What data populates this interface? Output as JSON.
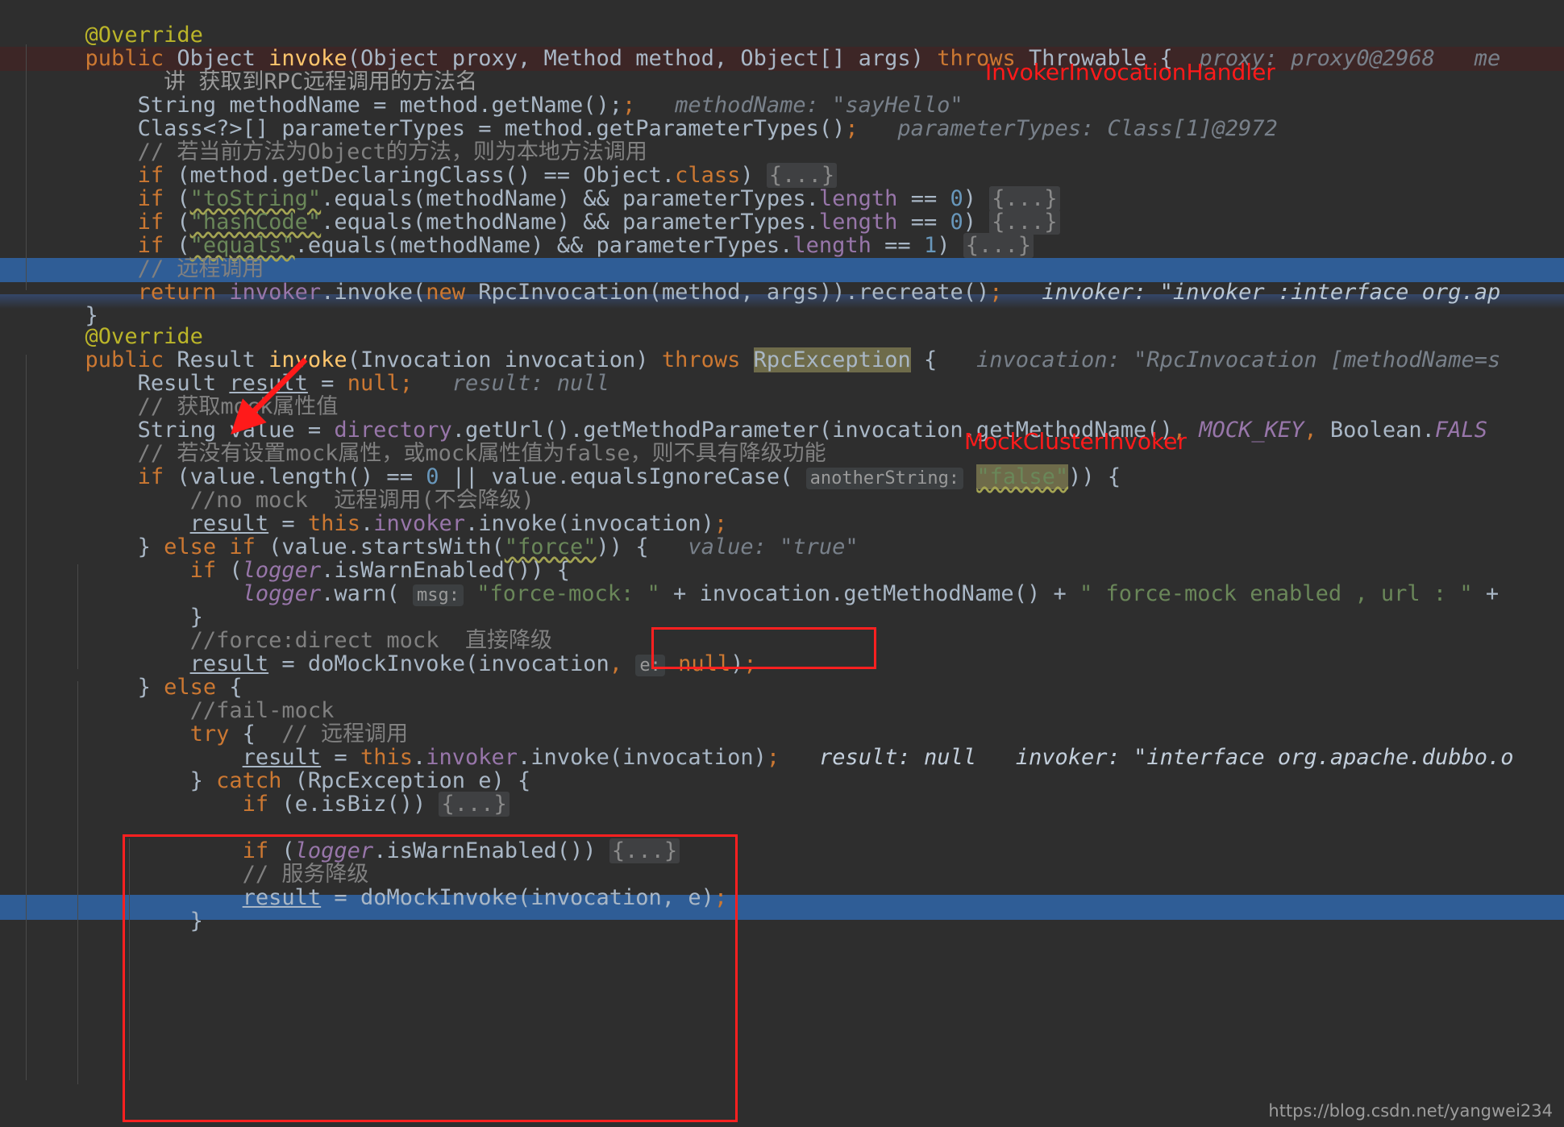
{
  "editor": {
    "theme": "darcula",
    "background": "#2e2e2e",
    "selection_color": "#2f5d96",
    "todo_color": "#3d2626",
    "accent_red": "#ff1a1a"
  },
  "annotations": {
    "class_label_top": "InvokerInvocationHandler",
    "class_label_bottom": "MockClusterInvoker"
  },
  "watermark": "https://blog.csdn.net/yangwei234",
  "lines": [
    {
      "id": "l01",
      "indent": 0,
      "text": "@Override"
    },
    {
      "id": "l02",
      "indent": 0,
      "text": "public Object invoke(Object proxy, Method method, Object[] args) throws Throwable {   proxy: proxy0@2968   me"
    },
    {
      "id": "l03",
      "indent": 1,
      "text": "讲 获取到RPC远程调用的方法名"
    },
    {
      "id": "l04",
      "indent": 1,
      "text": "String methodName = method.getName();   methodName: \"sayHello\""
    },
    {
      "id": "l05",
      "indent": 1,
      "text": "Class<?>[] parameterTypes = method.getParameterTypes();   parameterTypes: Class[1]@2972"
    },
    {
      "id": "l06",
      "indent": 1,
      "text": "// 若当前方法为Object的方法，则为本地方法调用"
    },
    {
      "id": "l07",
      "indent": 1,
      "text": "if (method.getDeclaringClass() == Object.class) {...}"
    },
    {
      "id": "l08",
      "indent": 1,
      "text": "if (\"toString\".equals(methodName) && parameterTypes.length == 0) {...}"
    },
    {
      "id": "l09",
      "indent": 1,
      "text": "if (\"hashCode\".equals(methodName) && parameterTypes.length == 0) {...}"
    },
    {
      "id": "l10",
      "indent": 1,
      "text": "if (\"equals\".equals(methodName) && parameterTypes.length == 1) {...}"
    },
    {
      "id": "l11",
      "indent": 1,
      "text": "// 远程调用"
    },
    {
      "id": "l12",
      "indent": 1,
      "text": "return invoker.invoke(new RpcInvocation(method, args)).recreate();   invoker: \"invoker :interface org.ap"
    },
    {
      "id": "l13",
      "indent": 0,
      "text": "}"
    },
    {
      "id": "l14",
      "indent": 0,
      "text": "@Override"
    },
    {
      "id": "l15",
      "indent": 0,
      "text": "public Result invoke(Invocation invocation) throws RpcException {   invocation: \"RpcInvocation [methodName=s"
    },
    {
      "id": "l16",
      "indent": 1,
      "text": "Result result = null;   result: null"
    },
    {
      "id": "l17",
      "indent": 1,
      "text": "// 获取mock属性值"
    },
    {
      "id": "l18",
      "indent": 1,
      "text": "String value = directory.getUrl().getMethodParameter(invocation.getMethodName(), MOCK_KEY, Boolean.FALS"
    },
    {
      "id": "l19",
      "indent": 1,
      "text": "// 若没有设置mock属性，或mock属性值为false，则不具有降级功能"
    },
    {
      "id": "l20",
      "indent": 1,
      "text": "if (value.length() == 0 || value.equalsIgnoreCase( anotherString: \"false\")) {"
    },
    {
      "id": "l21",
      "indent": 2,
      "text": "//no mock  远程调用(不会降级)"
    },
    {
      "id": "l22",
      "indent": 2,
      "text": "result = this.invoker.invoke(invocation);"
    },
    {
      "id": "l23",
      "indent": 1,
      "text": "} else if (value.startsWith(\"force\")) {   value: \"true\""
    },
    {
      "id": "l24",
      "indent": 2,
      "text": "if (logger.isWarnEnabled()) {"
    },
    {
      "id": "l25",
      "indent": 3,
      "text": "logger.warn( msg: \"force-mock: \" + invocation.getMethodName() + \" force-mock enabled , url : \" +"
    },
    {
      "id": "l26",
      "indent": 2,
      "text": "}"
    },
    {
      "id": "l27",
      "indent": 2,
      "text": "//force:direct mock  直接降级"
    },
    {
      "id": "l28",
      "indent": 2,
      "text": "result = doMockInvoke(invocation,  e: null);"
    },
    {
      "id": "l29",
      "indent": 1,
      "text": "} else {"
    },
    {
      "id": "l30",
      "indent": 2,
      "text": "//fail-mock"
    },
    {
      "id": "l31",
      "indent": 2,
      "text": "try {  // 远程调用"
    },
    {
      "id": "l32",
      "indent": 3,
      "text": "result = this.invoker.invoke(invocation);   result: null   invoker: \"interface org.apache.dubbo.o"
    },
    {
      "id": "l33",
      "indent": 2,
      "text": "} catch (RpcException e) {"
    },
    {
      "id": "l34",
      "indent": 3,
      "text": "if (e.isBiz()) {...}"
    },
    {
      "id": "l35",
      "indent": 3,
      "text": ""
    },
    {
      "id": "l36",
      "indent": 3,
      "text": "if (logger.isWarnEnabled()) {...}"
    },
    {
      "id": "l37",
      "indent": 3,
      "text": "// 服务降级"
    },
    {
      "id": "l38",
      "indent": 3,
      "text": "result = doMockInvoke(invocation, e);"
    },
    {
      "id": "l39",
      "indent": 2,
      "text": "}"
    }
  ],
  "inline_hints": [
    {
      "name": "proxy",
      "value": "proxy0@2968"
    },
    {
      "name": "methodName",
      "value": "\"sayHello\""
    },
    {
      "name": "parameterTypes",
      "value": "Class[1]@2972"
    },
    {
      "name": "invoker",
      "value": "\"invoker :interface org.ap"
    },
    {
      "name": "invocation",
      "value": "\"RpcInvocation [methodName=s"
    },
    {
      "name": "result",
      "value": "null"
    },
    {
      "name": "value",
      "value": "\"true\""
    }
  ],
  "parameter_hints": [
    "anotherString:",
    "msg:",
    "e:"
  ]
}
